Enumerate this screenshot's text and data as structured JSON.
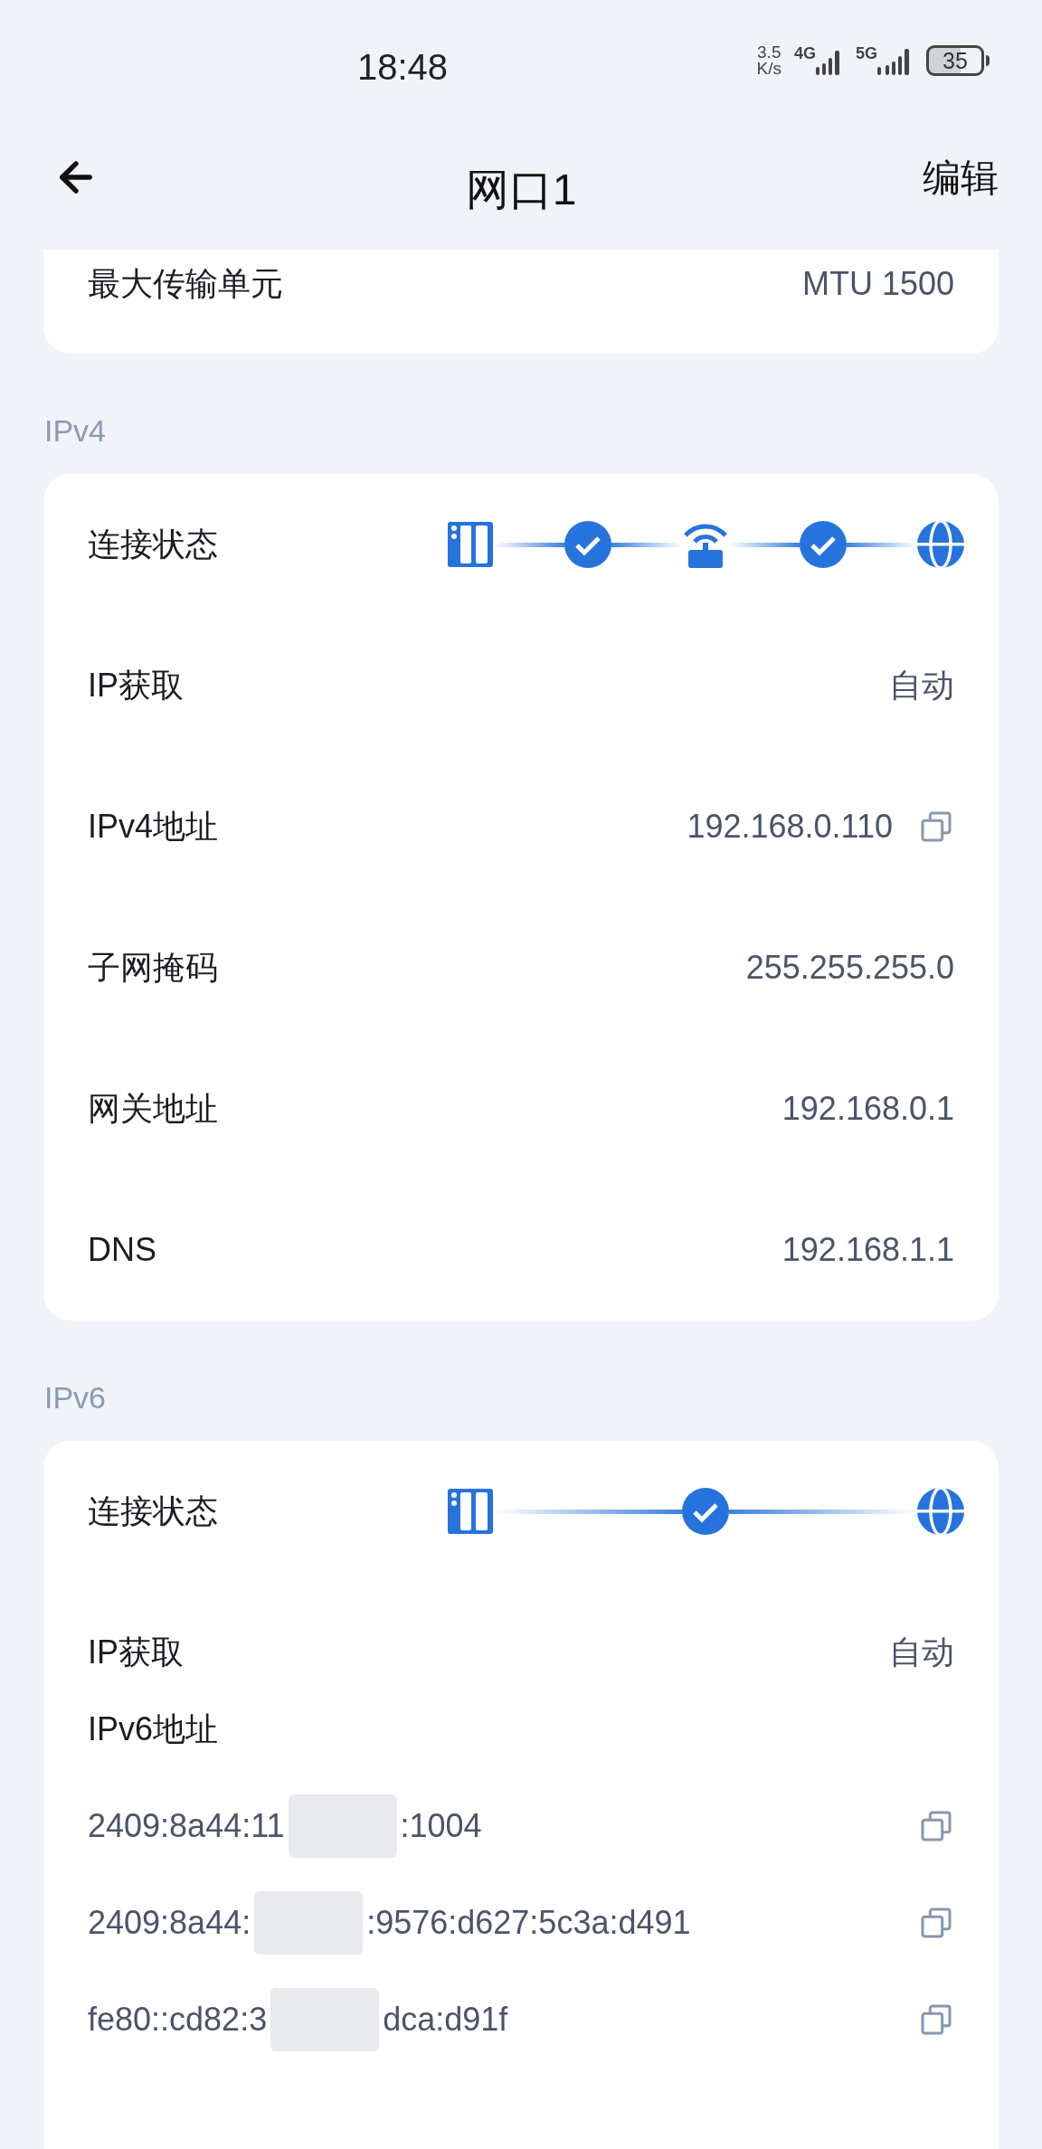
{
  "status_bar": {
    "time": "18:48",
    "speed_value": "3.5",
    "speed_unit": "K/s",
    "network_1": "4G",
    "network_2": "5G",
    "battery": "35"
  },
  "header": {
    "title": "网口1",
    "action": "编辑"
  },
  "top_card": {
    "rows": [
      {
        "label": "最大传输单元",
        "value": "MTU 1500"
      }
    ]
  },
  "ipv4": {
    "section_title": "IPv4",
    "connection_label": "连接状态",
    "steps": [
      {
        "kind": "device"
      },
      {
        "kind": "check"
      },
      {
        "kind": "router"
      },
      {
        "kind": "check"
      },
      {
        "kind": "globe"
      }
    ],
    "rows": [
      {
        "label": "IP获取",
        "value": "自动",
        "copyable": false
      },
      {
        "label": "IPv4地址",
        "value": "192.168.0.110",
        "copyable": true
      },
      {
        "label": "子网掩码",
        "value": "255.255.255.0",
        "copyable": false
      },
      {
        "label": "网关地址",
        "value": "192.168.0.1",
        "copyable": false
      },
      {
        "label": "DNS",
        "value": "192.168.1.1",
        "copyable": false
      }
    ]
  },
  "ipv6": {
    "section_title": "IPv6",
    "connection_label": "连接状态",
    "steps": [
      {
        "kind": "device"
      },
      {
        "kind": "check"
      },
      {
        "kind": "globe"
      }
    ],
    "rows": [
      {
        "label": "IP获取",
        "value": "自动"
      }
    ],
    "address_label": "IPv6地址",
    "addresses": [
      {
        "prefix": "2409:8a44:11",
        "suffix": ":1004"
      },
      {
        "prefix": "2409:8a44:",
        "suffix": ":9576:d627:5c3a:d491"
      },
      {
        "prefix": "fe80::cd82:3",
        "suffix": "dca:d91f"
      }
    ]
  }
}
